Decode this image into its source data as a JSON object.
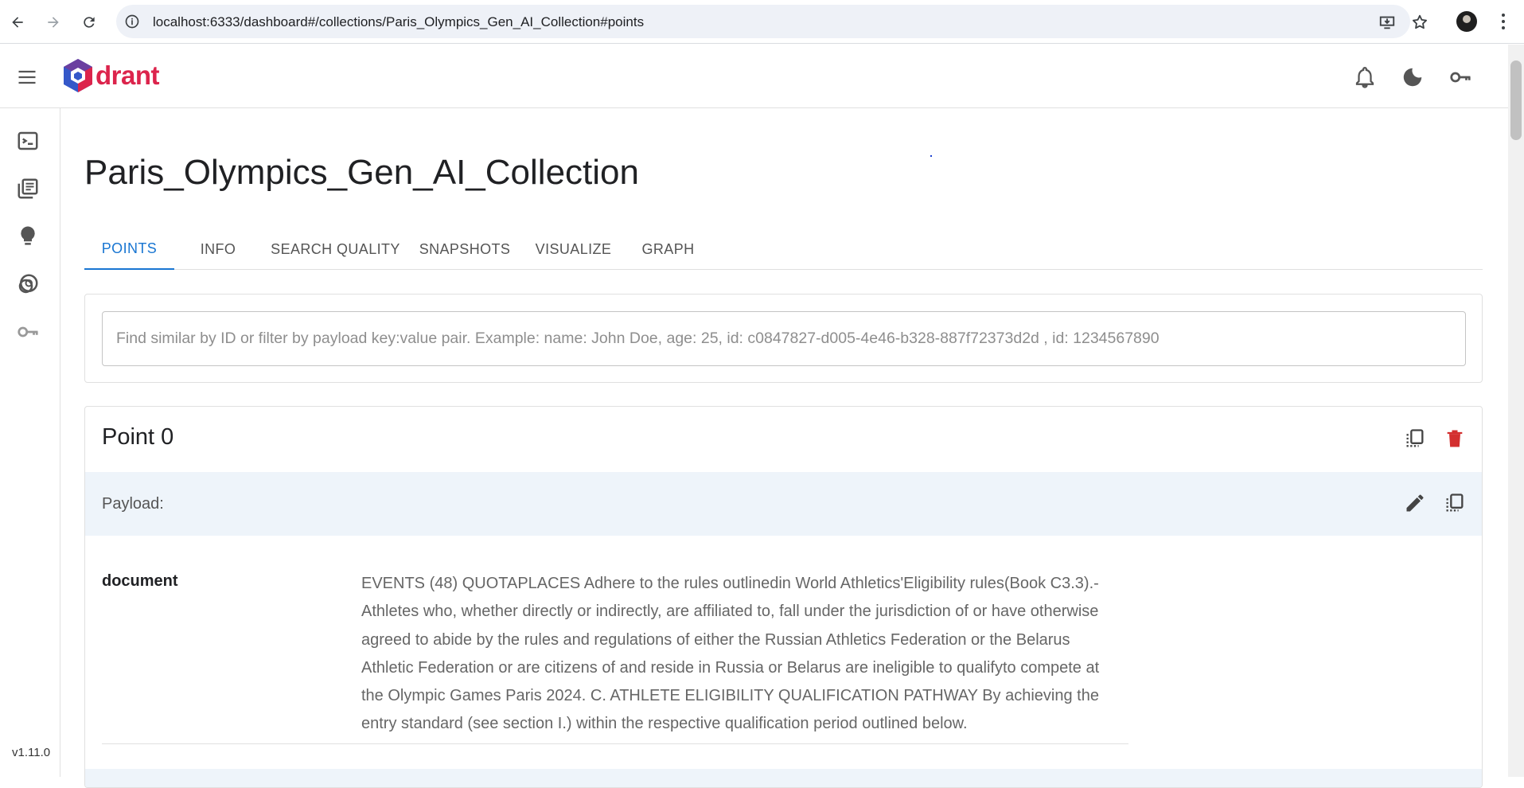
{
  "browser": {
    "url": "localhost:6333/dashboard#/collections/Paris_Olympics_Gen_AI_Collection#points"
  },
  "app": {
    "logo_text": "drant",
    "logo_colors": {
      "red": "#dc244c",
      "purple": "#6b3fa0",
      "blue": "#3558c9"
    },
    "version": "v1.11.0"
  },
  "sidebar": {
    "items": [
      {
        "icon": "console-icon"
      },
      {
        "icon": "collections-icon"
      },
      {
        "icon": "lightbulb-icon"
      },
      {
        "icon": "datasets-icon"
      },
      {
        "icon": "key-icon"
      }
    ]
  },
  "collection": {
    "title": "Paris_Olympics_Gen_AI_Collection",
    "tabs": [
      "POINTS",
      "INFO",
      "SEARCH QUALITY",
      "SNAPSHOTS",
      "VISUALIZE",
      "GRAPH"
    ],
    "active_tab": "POINTS"
  },
  "search": {
    "placeholder": "Find similar by ID or filter by payload key:value pair. Example: name: John Doe, age: 25, id: c0847827-d005-4e46-b328-887f72373d2d , id: 1234567890"
  },
  "point": {
    "title": "Point 0",
    "payload_label": "Payload:",
    "document_key": "document",
    "document_value": "EVENTS (48) QUOTAPLACES Adhere to the rules outlinedin World Athletics'Eligibility rules(Book C3.3).- Athletes who, whether directly or indirectly, are affiliated to, fall under the jurisdiction of or have otherwise agreed to abide by the rules and regulations of either the Russian Athletics Federation or the Belarus Athletic Federation or are citizens of and reside in Russia or Belarus are ineligible to qualifyto compete at the Olympic Games Paris 2024. C. ATHLETE ELIGIBILITY QUALIFICATION PATHWAY By achieving the entry standard (see section I.) within the respective qualification period outlined below."
  },
  "colors": {
    "accent": "#1976d2",
    "delete": "#d32f2f"
  }
}
